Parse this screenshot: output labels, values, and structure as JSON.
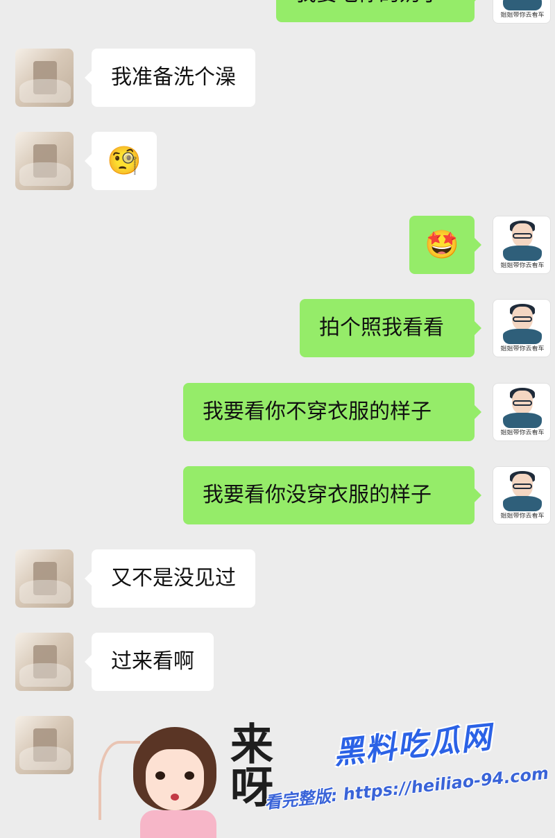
{
  "messages": [
    {
      "side": "right",
      "text": "我要吃你的奶子"
    },
    {
      "side": "left",
      "text": "我准备洗个澡"
    },
    {
      "side": "left",
      "emoji": "🧐",
      "emoji_name": "thinking-face-emoji"
    },
    {
      "side": "right",
      "emoji": "🤩",
      "emoji_name": "heart-eyes-emoji"
    },
    {
      "side": "right",
      "text": "拍个照我看看"
    },
    {
      "side": "right",
      "text": "我要看你不穿衣服的样子"
    },
    {
      "side": "right",
      "text": "我要看你没穿衣服的样子"
    },
    {
      "side": "left",
      "text": "又不是没见过"
    },
    {
      "side": "left",
      "text": "过来看啊"
    }
  ],
  "sticker": {
    "text": "来呀"
  },
  "right_avatar": {
    "caption": "姐姐带你去看车"
  },
  "watermark": {
    "brand": "黑料吃瓜网",
    "url_text": "看完整版: https://heiliao-94.com"
  },
  "colors": {
    "background": "#ececec",
    "bubble_right": "#95ec69",
    "bubble_left": "#ffffff",
    "watermark_blue": "#2b62e6"
  }
}
